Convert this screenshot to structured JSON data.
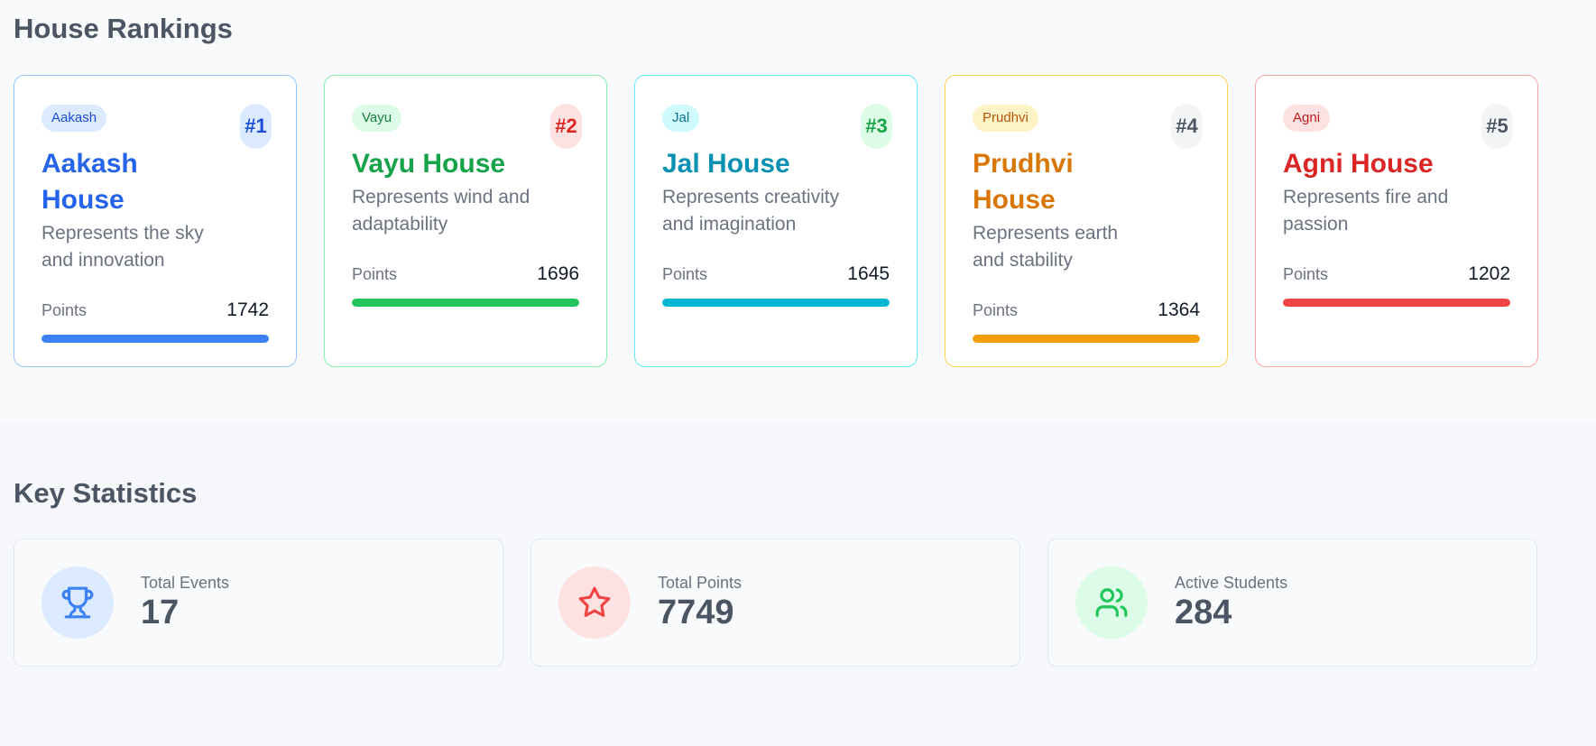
{
  "sections": {
    "rankings_title": "House Rankings",
    "stats_title": "Key Statistics"
  },
  "houses": [
    {
      "tag": "Aakash",
      "rank": "#1",
      "name": "Aakash House",
      "desc": "Represents the sky and innovation",
      "points_label": "Points",
      "points": "1742",
      "progress": 1.0,
      "color": "#2563eb",
      "bar_color": "#3b82f6",
      "border": "#93c5fd",
      "tag_bg": "#dbeafe",
      "tag_fg": "#1d4ed8",
      "badge_bg": "#dbeafe",
      "badge_fg": "#1d4ed8"
    },
    {
      "tag": "Vayu",
      "rank": "#2",
      "name": "Vayu House",
      "desc": "Represents wind and adaptability",
      "points_label": "Points",
      "points": "1696",
      "progress": 1.0,
      "color": "#16a34a",
      "bar_color": "#22c55e",
      "border": "#86efac",
      "tag_bg": "#dcfce7",
      "tag_fg": "#15803d",
      "badge_bg": "#fee2e2",
      "badge_fg": "#dc2626"
    },
    {
      "tag": "Jal",
      "rank": "#3",
      "name": "Jal House",
      "desc": "Represents creativity and imagination",
      "points_label": "Points",
      "points": "1645",
      "progress": 1.0,
      "color": "#0891b2",
      "bar_color": "#06b6d4",
      "border": "#67e8f9",
      "tag_bg": "#cffafe",
      "tag_fg": "#0e7490",
      "badge_bg": "#dcfce7",
      "badge_fg": "#16a34a"
    },
    {
      "tag": "Prudhvi",
      "rank": "#4",
      "name": "Prudhvi House",
      "desc": "Represents earth and stability",
      "points_label": "Points",
      "points": "1364",
      "progress": 1.0,
      "color": "#d97706",
      "bar_color": "#f59e0b",
      "border": "#fcd34d",
      "tag_bg": "#fef3c7",
      "tag_fg": "#b45309",
      "badge_bg": "#f3f4f6",
      "badge_fg": "#4b5563"
    },
    {
      "tag": "Agni",
      "rank": "#5",
      "name": "Agni House",
      "desc": "Represents fire and passion",
      "points_label": "Points",
      "points": "1202",
      "progress": 1.0,
      "color": "#dc2626",
      "bar_color": "#ef4444",
      "border": "#fca5a5",
      "tag_bg": "#fee2e2",
      "tag_fg": "#b91c1c",
      "badge_bg": "#f3f4f6",
      "badge_fg": "#4b5563"
    }
  ],
  "stats": [
    {
      "label": "Total Events",
      "value": "17",
      "icon": "trophy-icon",
      "icon_color": "#3b82f6",
      "icon_bg": "#dbeafe"
    },
    {
      "label": "Total Points",
      "value": "7749",
      "icon": "star-icon",
      "icon_color": "#ef4444",
      "icon_bg": "#fee2e2"
    },
    {
      "label": "Active Students",
      "value": "284",
      "icon": "users-icon",
      "icon_color": "#22c55e",
      "icon_bg": "#dcfce7"
    }
  ]
}
